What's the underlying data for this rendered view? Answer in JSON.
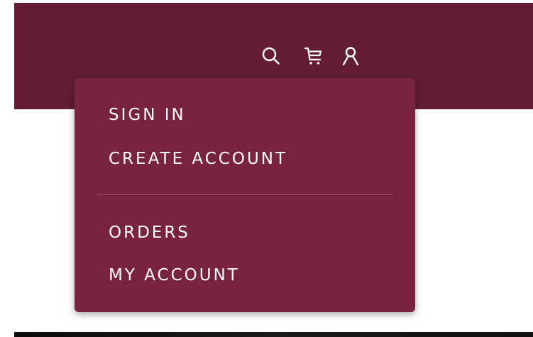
{
  "colors": {
    "header_bg": "#631d34",
    "dropdown_bg": "#782340",
    "divider": "#9a4a62",
    "text": "#ffffff"
  },
  "header": {
    "icons": [
      "search-icon",
      "cart-icon",
      "user-icon"
    ]
  },
  "account_menu": {
    "items_top": [
      {
        "label": "SIGN IN"
      },
      {
        "label": "CREATE ACCOUNT"
      }
    ],
    "items_bottom": [
      {
        "label": "ORDERS"
      },
      {
        "label": "MY ACCOUNT"
      }
    ]
  }
}
